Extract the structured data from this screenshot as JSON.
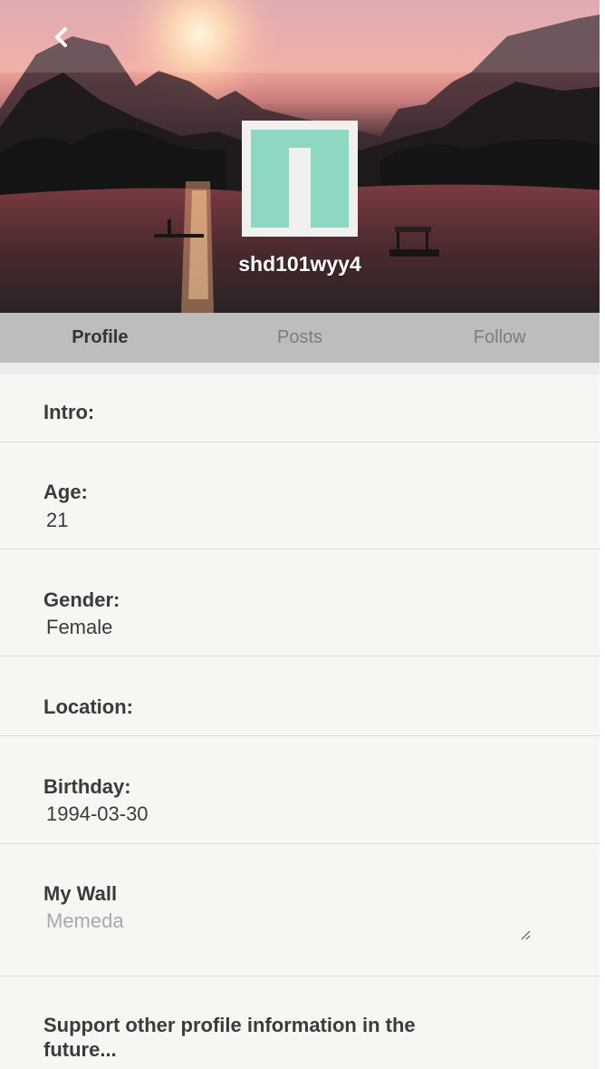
{
  "header": {
    "username": "shd101wyy4",
    "back_icon": "chevron-left-icon"
  },
  "tabs": [
    {
      "label": "Profile",
      "active": true
    },
    {
      "label": "Posts",
      "active": false
    },
    {
      "label": "Follow",
      "active": false
    }
  ],
  "profile": {
    "intro": {
      "label": "Intro:",
      "value": ""
    },
    "age": {
      "label": "Age:",
      "value": "21"
    },
    "gender": {
      "label": "Gender:",
      "value": "Female"
    },
    "location": {
      "label": "Location:",
      "value": ""
    },
    "birthday": {
      "label": "Birthday:",
      "value": "1994-03-30"
    },
    "wall": {
      "label": "My Wall",
      "placeholder": "Memeda",
      "value": ""
    }
  },
  "footer_note": "Support other profile information in the future...",
  "colors": {
    "avatar_tile": "#8ed8c3",
    "tab_bar": "#bdbdbd",
    "page_background": "#f7f6f3"
  }
}
